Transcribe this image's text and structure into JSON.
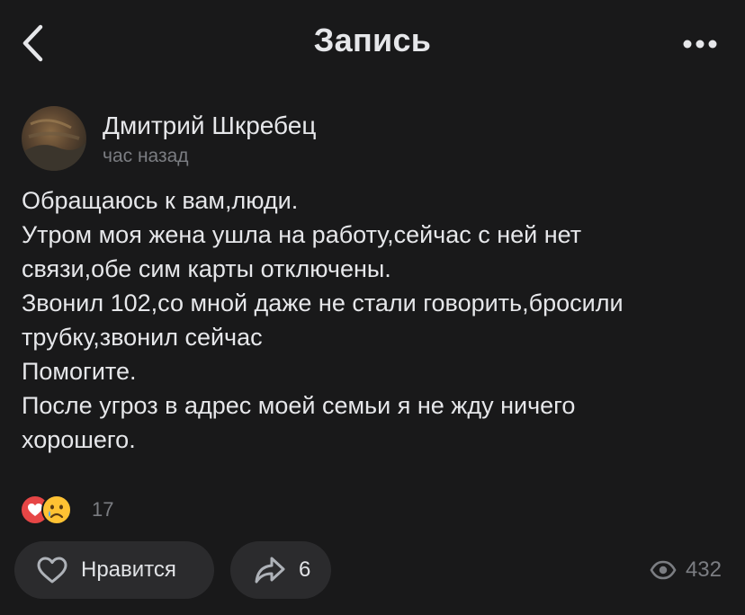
{
  "header": {
    "title": "Запись",
    "back_icon": "chevron-left-icon",
    "more_icon": "more-horizontal-icon"
  },
  "author": {
    "name": "Дмитрий Шкребец",
    "time": "час назад"
  },
  "post": {
    "lines": [
      "Обращаюсь к вам,люди.",
      "Утром моя жена ушла на работу,сейчас с ней нет",
      "связи,обе сим карты отключены.",
      "Звонил 102,со мной даже не стали говорить,бросили",
      "трубку,звонил сейчас",
      "Помогите.",
      "После угроз в адрес моей семьи я не жду ничего",
      "хорошего."
    ]
  },
  "reactions": {
    "count": "17",
    "icons": [
      "heart-reaction-icon",
      "crying-reaction-icon"
    ]
  },
  "actions": {
    "like_label": "Нравится",
    "share_count": "6",
    "views_count": "432"
  },
  "colors": {
    "background": "#19191a",
    "button_bg": "#2b2b2d",
    "text": "#e1e3e6",
    "secondary": "#7b7d82",
    "heart": "#e64646",
    "emoji": "#ffc233"
  }
}
